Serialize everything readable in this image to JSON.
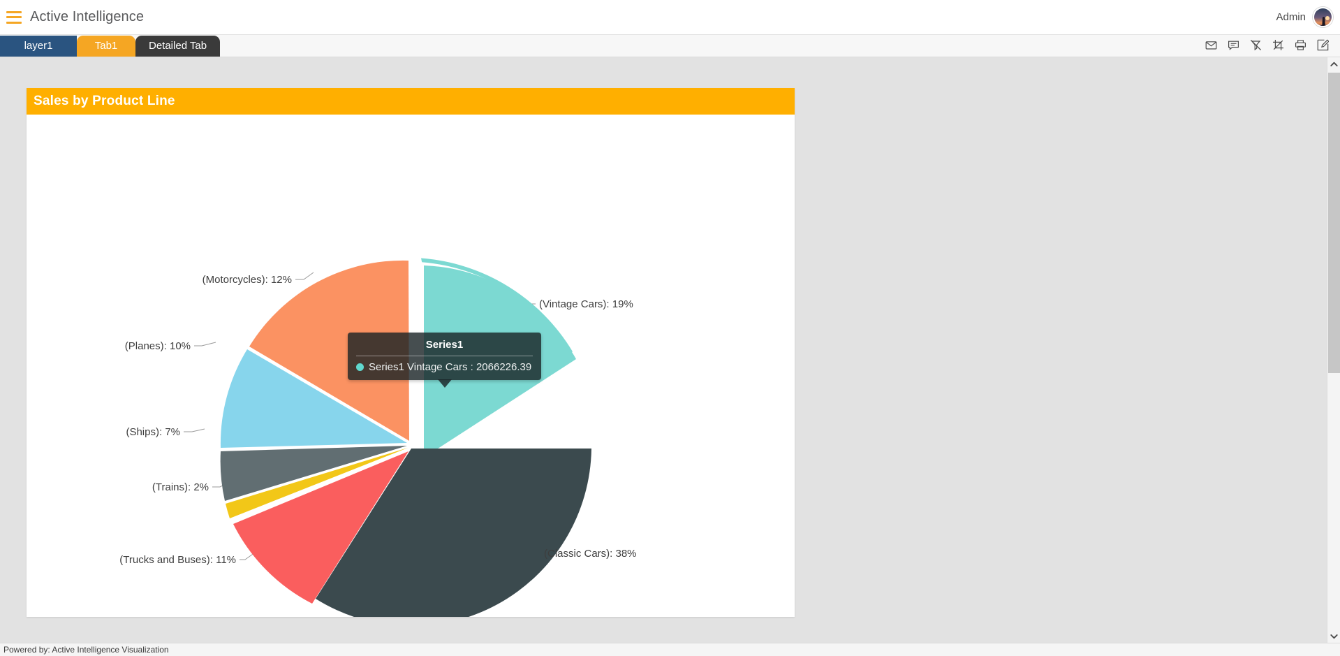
{
  "header": {
    "menu_icon": "hamburger-icon",
    "title": "Active Intelligence",
    "user_label": "Admin",
    "avatar_icon": "user-avatar"
  },
  "tabs": [
    {
      "label": "layer1",
      "state": "inactive",
      "color": "#2a5480"
    },
    {
      "label": "Tab1",
      "state": "active",
      "color": "#F5A623"
    },
    {
      "label": "Detailed Tab",
      "state": "inactive",
      "color": "#3a3a3a"
    }
  ],
  "toolbar": {
    "icons": [
      {
        "name": "mail-icon",
        "title": "Email"
      },
      {
        "name": "comment-icon",
        "title": "Comment"
      },
      {
        "name": "filter-off-icon",
        "title": "Clear Filter"
      },
      {
        "name": "crop-icon",
        "title": "Crop"
      },
      {
        "name": "print-icon",
        "title": "Print"
      },
      {
        "name": "edit-icon",
        "title": "Edit"
      }
    ]
  },
  "panel": {
    "title": "Sales by Product Line",
    "header_color": "#FFAF00"
  },
  "tooltip": {
    "title": "Series1",
    "row": "Series1 Vintage Cars : 2066226.39",
    "dot_color": "#60D8CE"
  },
  "footer": {
    "text": "Powered by: Active Intelligence Visualization"
  },
  "scrollbar": {
    "up_arrow": "chevron-up-icon",
    "down_arrow": "chevron-down-icon"
  },
  "chart_data": {
    "type": "pie",
    "title": "Sales by Product Line",
    "series_name": "Series1",
    "categories": [
      "Vintage Cars",
      "Classic Cars",
      "Trucks and Buses",
      "Trains",
      "Ships",
      "Planes",
      "Motorcycles"
    ],
    "values": [
      19,
      38,
      11,
      2,
      7,
      10,
      12
    ],
    "value_unit": "percent",
    "labels": [
      "(Vintage Cars): 19%",
      "(Classic Cars): 38%",
      "(Trucks and Buses): 11%",
      "(Trains): 2%",
      "(Ships): 7%",
      "(Planes): 10%",
      "(Motorcycles): 12%"
    ],
    "colors": [
      "#7CD9D2",
      "#3B4A4E",
      "#FA5E5E",
      "#F2C718",
      "#616E72",
      "#87D5EC",
      "#FB9262"
    ],
    "highlighted_slice": "Vintage Cars",
    "highlighted_value": 2066226.39,
    "legend": false,
    "data_labels": true,
    "xlabel": "",
    "ylabel": ""
  }
}
